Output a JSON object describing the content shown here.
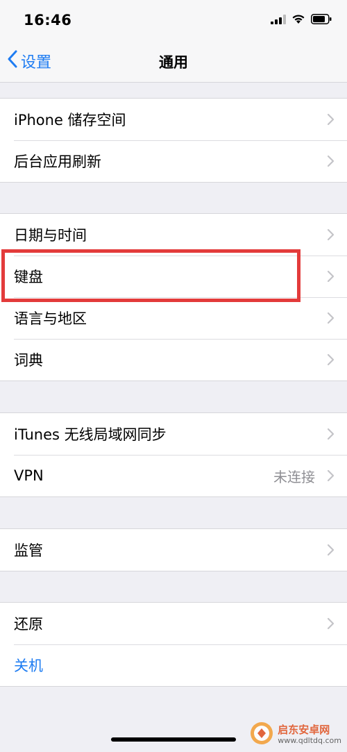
{
  "status_bar": {
    "time": "16:46"
  },
  "nav": {
    "back_label": "设置",
    "title": "通用"
  },
  "groups": [
    {
      "rows": [
        {
          "label": "iPhone 储存空间"
        },
        {
          "label": "后台应用刷新"
        }
      ]
    },
    {
      "rows": [
        {
          "label": "日期与时间"
        },
        {
          "label": "键盘"
        },
        {
          "label": "语言与地区"
        },
        {
          "label": "词典"
        }
      ]
    },
    {
      "rows": [
        {
          "label": "iTunes 无线局域网同步"
        },
        {
          "label": "VPN",
          "value": "未连接"
        }
      ]
    },
    {
      "rows": [
        {
          "label": "监管"
        }
      ]
    },
    {
      "rows": [
        {
          "label": "还原"
        },
        {
          "label": "关机"
        }
      ]
    }
  ],
  "watermark": {
    "name": "启东安卓网",
    "url": "www.qdltdq.com"
  },
  "colors": {
    "accent": "#1e7cf2",
    "highlight": "#e33b3b",
    "background": "#efeff4"
  }
}
